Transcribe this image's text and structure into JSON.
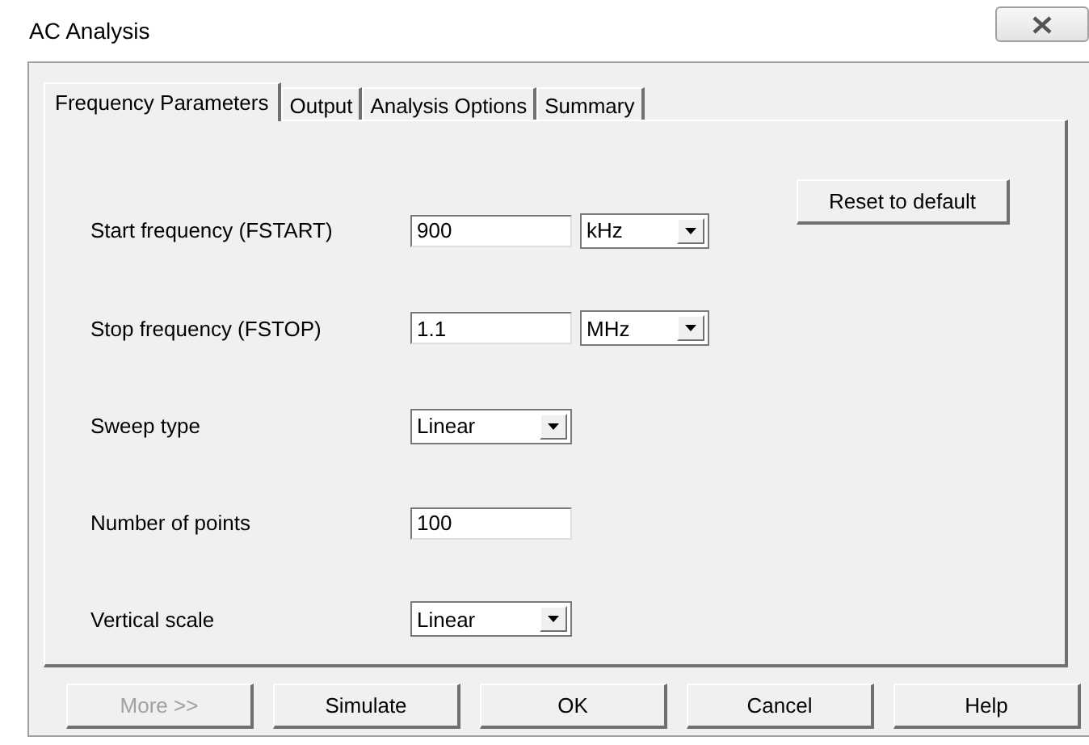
{
  "window": {
    "title": "AC Analysis"
  },
  "tabs": [
    {
      "label": "Frequency Parameters",
      "selected": true
    },
    {
      "label": "Output",
      "selected": false
    },
    {
      "label": "Analysis Options",
      "selected": false
    },
    {
      "label": "Summary",
      "selected": false
    }
  ],
  "rows": [
    {
      "label": "Start frequency (FSTART)",
      "kind": "text",
      "value": "900",
      "unit": "kHz"
    },
    {
      "label": "Stop frequency (FSTOP)",
      "kind": "text",
      "value": "1.1",
      "unit": "MHz"
    },
    {
      "label": "Sweep type",
      "kind": "select",
      "value": "Linear"
    },
    {
      "label": "Number of points",
      "kind": "text",
      "value": "100"
    },
    {
      "label": "Vertical scale",
      "kind": "select",
      "value": "Linear"
    }
  ],
  "reset_button": "Reset to default",
  "buttons": [
    {
      "label": "More >>",
      "disabled": true
    },
    {
      "label": "Simulate",
      "disabled": false
    },
    {
      "label": "OK",
      "disabled": false
    },
    {
      "label": "Cancel",
      "disabled": false
    },
    {
      "label": "Help",
      "disabled": false
    }
  ]
}
